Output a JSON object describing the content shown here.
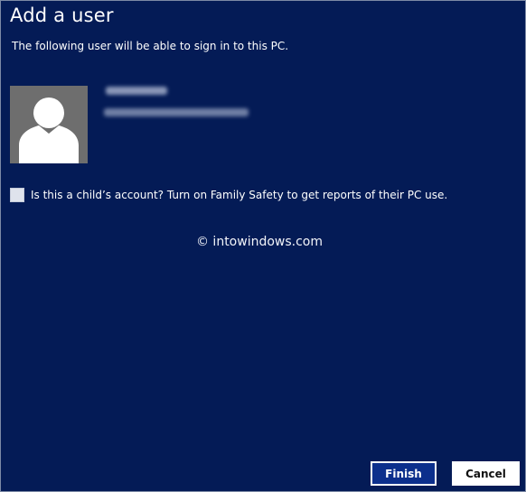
{
  "dialog": {
    "title": "Add a user",
    "subtitle": "The following user will be able to sign in to this PC."
  },
  "user": {
    "avatar_icon": "user-silhouette-icon",
    "name": "",
    "email": ""
  },
  "child_account": {
    "checked": false,
    "label": "Is this a child’s account? Turn on Family Safety to get reports of their PC use."
  },
  "watermark": "© intowindows.com",
  "buttons": {
    "finish": "Finish",
    "cancel": "Cancel"
  },
  "colors": {
    "background": "#041b56",
    "finish_button": "#0c2f8c",
    "avatar_bg": "#6e6e6e"
  }
}
